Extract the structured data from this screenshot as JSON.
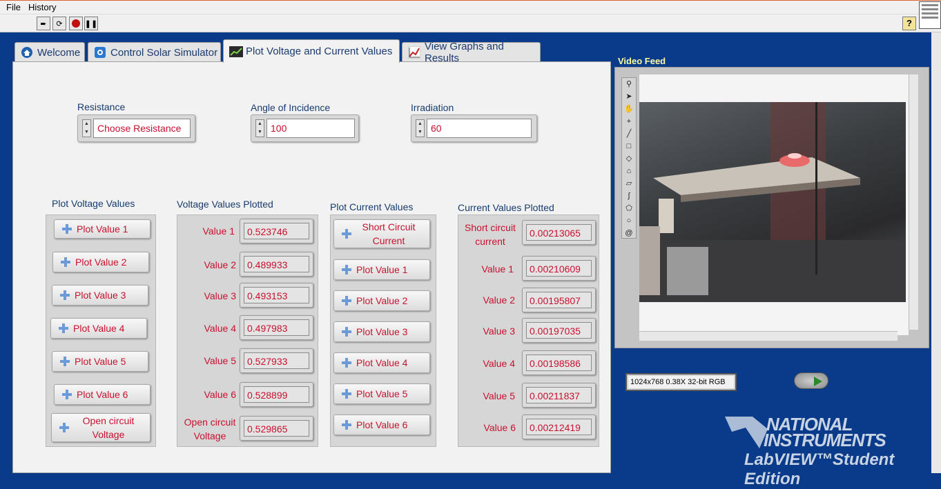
{
  "menu": {
    "file": "File",
    "history": "History"
  },
  "toolbar": {
    "help": "?"
  },
  "tabs": [
    {
      "label": "Welcome"
    },
    {
      "label": "Control Solar Simulator"
    },
    {
      "label": "Plot Voltage and Current Values"
    },
    {
      "label": "View Graphs and Results"
    }
  ],
  "controls": {
    "resistance": {
      "label": "Resistance",
      "value": "Choose Resistance"
    },
    "angle": {
      "label": "Angle of Incidence",
      "value": "100"
    },
    "irradiation": {
      "label": "Irradiation",
      "value": "60"
    }
  },
  "plot_voltage": {
    "title": "Plot Voltage Values",
    "buttons": [
      "Plot Value 1",
      "Plot Value 2",
      "Plot Value 3",
      "Plot Value 4",
      "Plot Value 5",
      "Plot Value 6",
      "Open circuit Voltage"
    ]
  },
  "voltage_plotted": {
    "title": "Voltage Values Plotted",
    "rows": [
      {
        "label": "Value 1",
        "value": "0.523746"
      },
      {
        "label": "Value 2",
        "value": "0.489933"
      },
      {
        "label": "Value 3",
        "value": "0.493153"
      },
      {
        "label": "Value 4",
        "value": "0.497983"
      },
      {
        "label": "Value 5",
        "value": "0.527933"
      },
      {
        "label": "Value 6",
        "value": "0.528899"
      },
      {
        "label": "Open circuit Voltage",
        "value": "0.529865"
      }
    ]
  },
  "plot_current": {
    "title": "Plot Current Values",
    "buttons": [
      "Short Circuit Current",
      "Plot Value 1",
      "Plot Value 2",
      "Plot Value 3",
      "Plot Value 4",
      "Plot Value 5",
      "Plot Value 6"
    ]
  },
  "current_plotted": {
    "title": "Current Values Plotted",
    "rows": [
      {
        "label": "Short circuit current",
        "value": "0.00213065"
      },
      {
        "label": "Value 1",
        "value": "0.00210609"
      },
      {
        "label": "Value 2",
        "value": "0.00195807"
      },
      {
        "label": "Value 3",
        "value": "0.00197035"
      },
      {
        "label": "Value 4",
        "value": "0.00198586"
      },
      {
        "label": "Value 5",
        "value": "0.00211837"
      },
      {
        "label": "Value 6",
        "value": "0.00212419"
      }
    ]
  },
  "video": {
    "title": "Video Feed",
    "info": "1024x768 0.38X 32-bit RGB"
  },
  "branding": {
    "line1": "NATIONAL",
    "line2": "INSTRUMENTS",
    "line3": "LabVIEW™Student Edition"
  }
}
